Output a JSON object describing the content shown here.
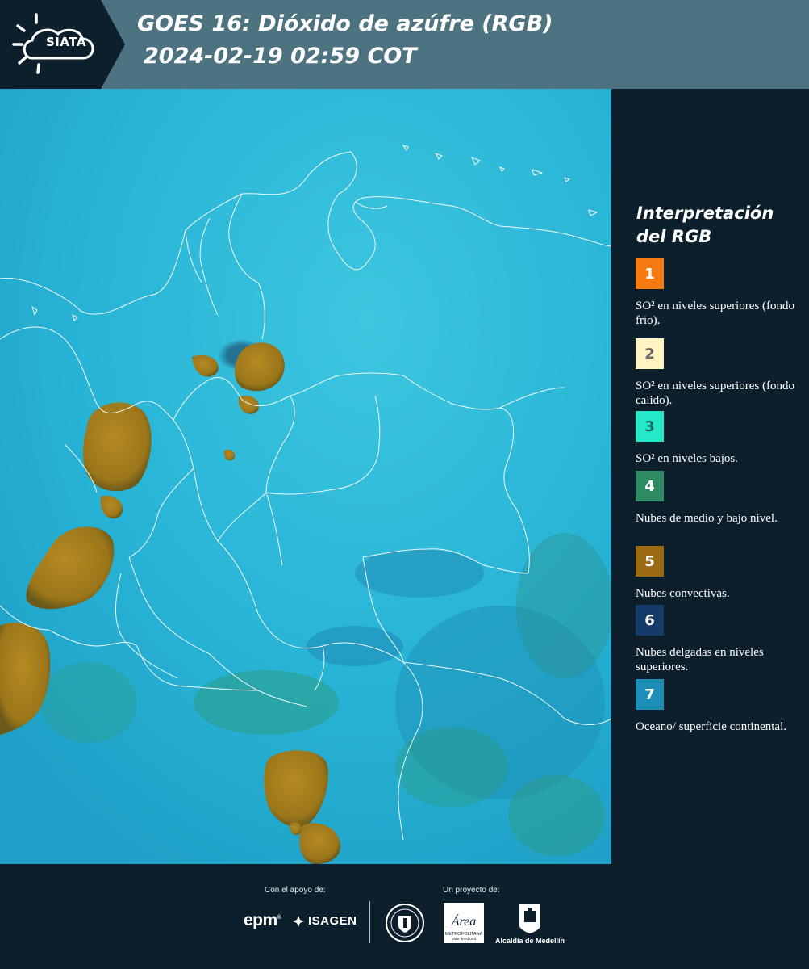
{
  "header": {
    "logo_text": "SIATA",
    "title_line1": "GOES 16: Dióxido de azúfre (RGB)",
    "title_line2": "2024-02-19 02:59 COT"
  },
  "legend": {
    "title_line1": "Interpretación",
    "title_line2": "del RGB",
    "items": [
      {
        "number": "1",
        "label": "SO² en niveles superiores (fondo frio).",
        "color": "#f57a12",
        "text_color": "#ffffff"
      },
      {
        "number": "2",
        "label": "SO² en niveles superiores (fondo calido).",
        "color": "#fff3c2",
        "text_color": "#6b6b6b"
      },
      {
        "number": "3",
        "label": "SO² en niveles bajos.",
        "color": "#25e8c8",
        "text_color": "#1d6f63"
      },
      {
        "number": "4",
        "label": "Nubes de medio y bajo nivel.",
        "color": "#2e8a62",
        "text_color": "#ffffff"
      },
      {
        "number": "5",
        "label": "Nubes convectivas.",
        "color": "#9b6a12",
        "text_color": "#ffffff"
      },
      {
        "number": "6",
        "label": "Nubes delgadas en niveles superiores.",
        "color": "#153b6a",
        "text_color": "#ffffff"
      },
      {
        "number": "7",
        "label": "Oceano/ superficie continental.",
        "color": "#1b8fb5",
        "text_color": "#ffffff"
      }
    ]
  },
  "footer": {
    "support_label": "Con el apoyo de:",
    "project_label": "Un proyecto de:",
    "epm": "epm",
    "isagen": "ISAGEN",
    "area_name": "Área",
    "area_sub": "METROPOLITANA",
    "area_sub2": "Valle de Aburrá",
    "alcaldia": "Alcaldía de Medellín"
  },
  "colors": {
    "header_bg": "#4e7380",
    "logo_bg": "#0e1f2c",
    "map_ocean": "#26b5d6",
    "cloud_brown": "#a47c1c",
    "page_bg": "#0e1f2c"
  }
}
